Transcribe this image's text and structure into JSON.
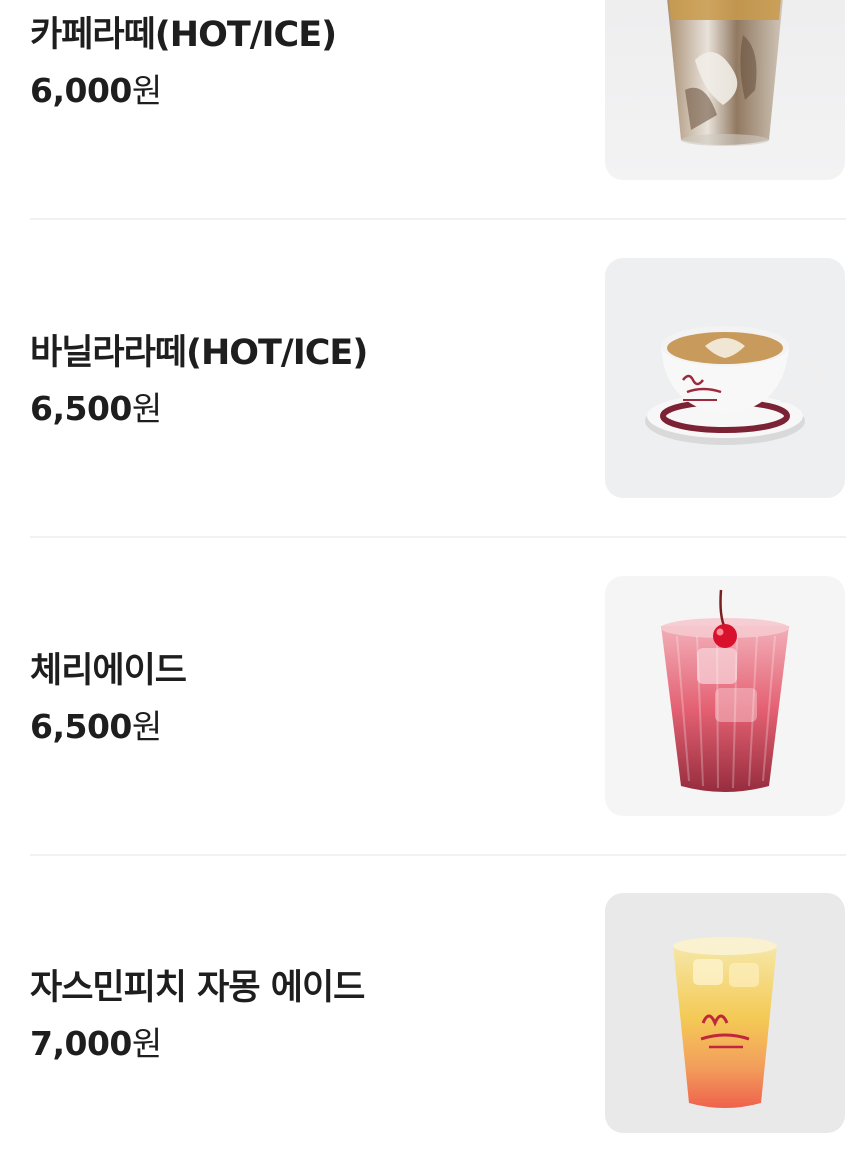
{
  "menu": {
    "items": [
      {
        "name": "카페라떼(HOT/ICE)",
        "price": "6,000",
        "currency": "원",
        "image_icon": "iced-cafe-latte-photo"
      },
      {
        "name": "바닐라라떼(HOT/ICE)",
        "price": "6,500",
        "currency": "원",
        "image_icon": "vanilla-latte-cup-photo"
      },
      {
        "name": "체리에이드",
        "price": "6,500",
        "currency": "원",
        "image_icon": "cherry-ade-glass-photo"
      },
      {
        "name": "자스민피치 자몽 에이드",
        "price": "7,000",
        "currency": "원",
        "image_icon": "jasmine-peach-grapefruit-ade-photo"
      }
    ]
  },
  "colors": {
    "text": "#1e1e1e",
    "divider": "#f1f1f1",
    "photo_background": "#f2f2f3",
    "logo_red": "#b5283b"
  }
}
